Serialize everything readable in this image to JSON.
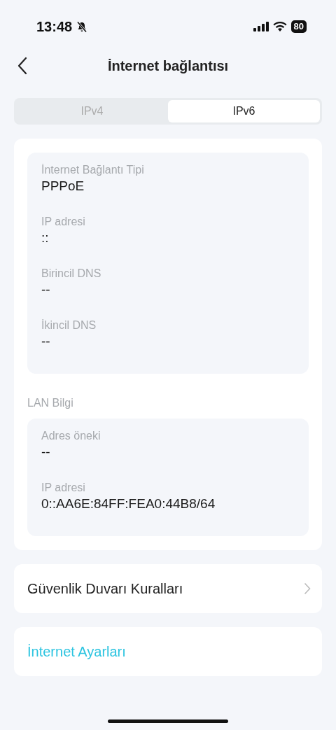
{
  "status_bar": {
    "time": "13:48",
    "battery": "80"
  },
  "header": {
    "title": "İnternet bağlantısı"
  },
  "tabs": [
    {
      "label": "IPv4",
      "selected": false
    },
    {
      "label": "IPv6",
      "selected": true
    }
  ],
  "wan_fields": [
    {
      "label": "İnternet Bağlantı Tipi",
      "value": "PPPoE"
    },
    {
      "label": "IP adresi",
      "value": "::"
    },
    {
      "label": "Birincil DNS",
      "value": "--"
    },
    {
      "label": "İkincil DNS",
      "value": "--"
    }
  ],
  "lan": {
    "heading": "LAN Bilgi",
    "fields": [
      {
        "label": "Adres öneki",
        "value": "--"
      },
      {
        "label": "IP adresi",
        "value": "0::AA6E:84FF:FEA0:44B8/64"
      }
    ]
  },
  "menu": [
    {
      "label": "Güvenlik Duvarı Kuralları",
      "kind": "chevron"
    },
    {
      "label": "İnternet Ayarları",
      "kind": "link"
    }
  ]
}
